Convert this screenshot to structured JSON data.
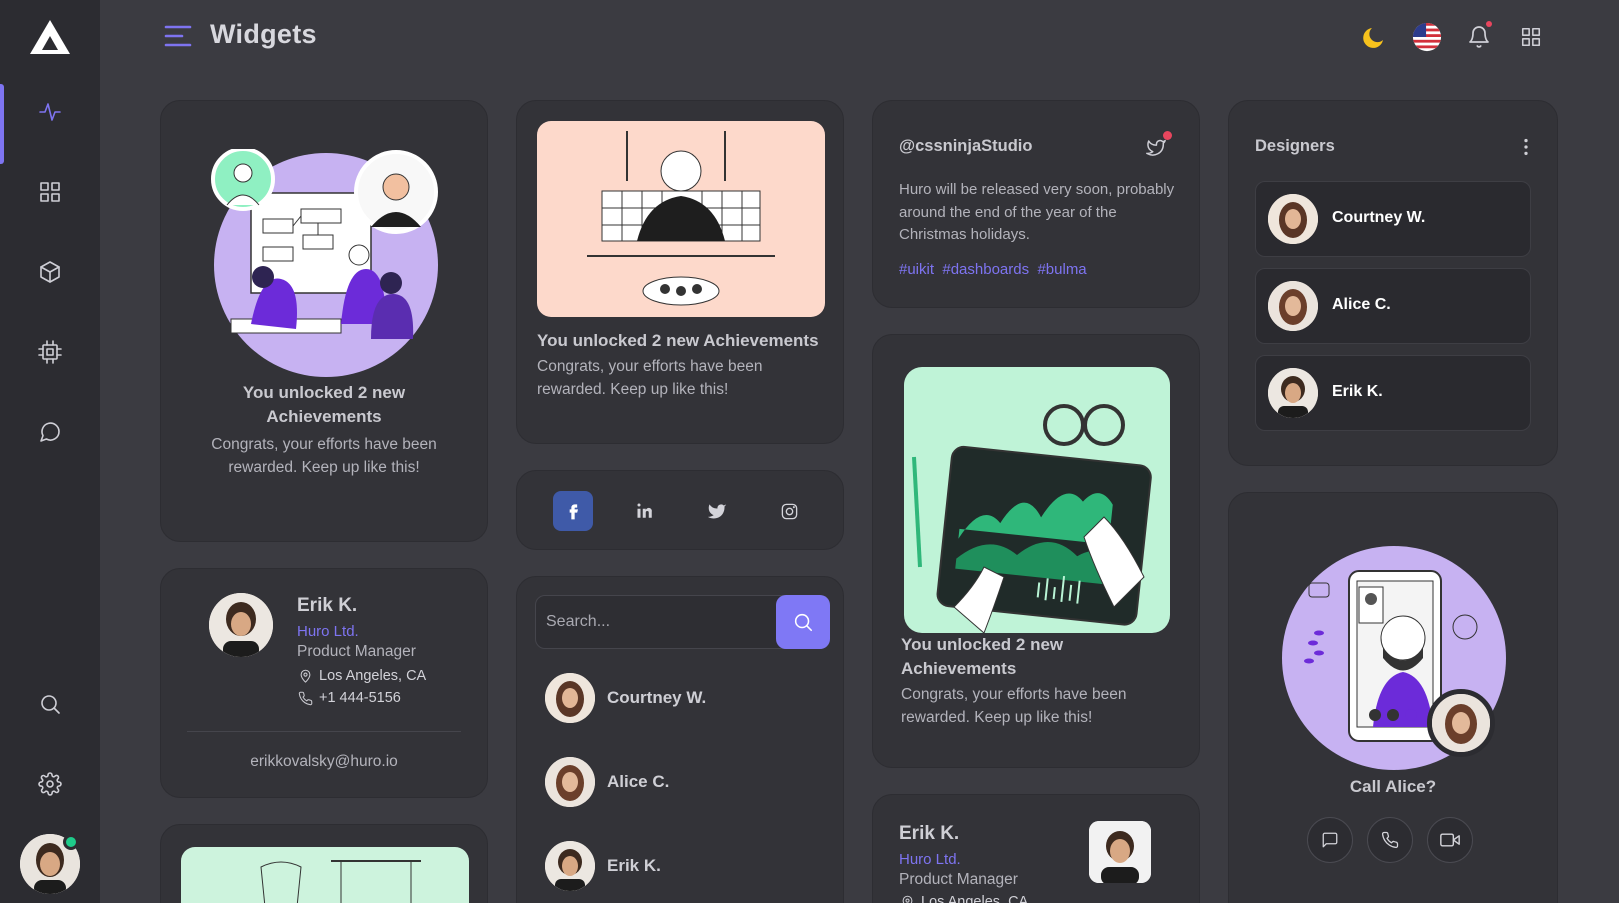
{
  "page": {
    "title": "Widgets"
  },
  "colors": {
    "accent": "#7e74f1",
    "online": "#1ecb8a",
    "facebook": "#3f5aa8",
    "moon": "#f7c21d"
  },
  "achievement": {
    "title": "You unlocked 2 new Achievements",
    "text": "Congrats, your efforts have been rewarded. Keep up like this!"
  },
  "profile": {
    "name": "Erik K.",
    "company": "Huro Ltd.",
    "role": "Product Manager",
    "location": "Los Angeles, CA",
    "phone": "+1 444-5156",
    "email": "erikkovalsky@huro.io"
  },
  "tweet": {
    "handle": "@cssninjaStudio",
    "text": "Huro will be released very soon, probably around the end of the year of the Christmas holidays.",
    "tags": [
      "#uikit",
      "#dashboards",
      "#bulma"
    ]
  },
  "designers": {
    "title": "Designers",
    "people": [
      "Courtney W.",
      "Alice C.",
      "Erik K."
    ]
  },
  "search": {
    "placeholder": "Search...",
    "results": [
      "Courtney W.",
      "Alice C.",
      "Erik K."
    ]
  },
  "call": {
    "title": "Call Alice?"
  },
  "profile2": {
    "name": "Erik K.",
    "company": "Huro Ltd.",
    "role": "Product Manager",
    "location": "Los Angeles, CA"
  },
  "icons": {
    "sidebar": [
      "activity-icon",
      "grid-icon",
      "box-icon",
      "cpu-icon",
      "chat-icon",
      "search-icon",
      "gear-icon"
    ],
    "social": [
      "facebook-icon",
      "linkedin-icon",
      "twitter-icon",
      "instagram-icon"
    ]
  }
}
